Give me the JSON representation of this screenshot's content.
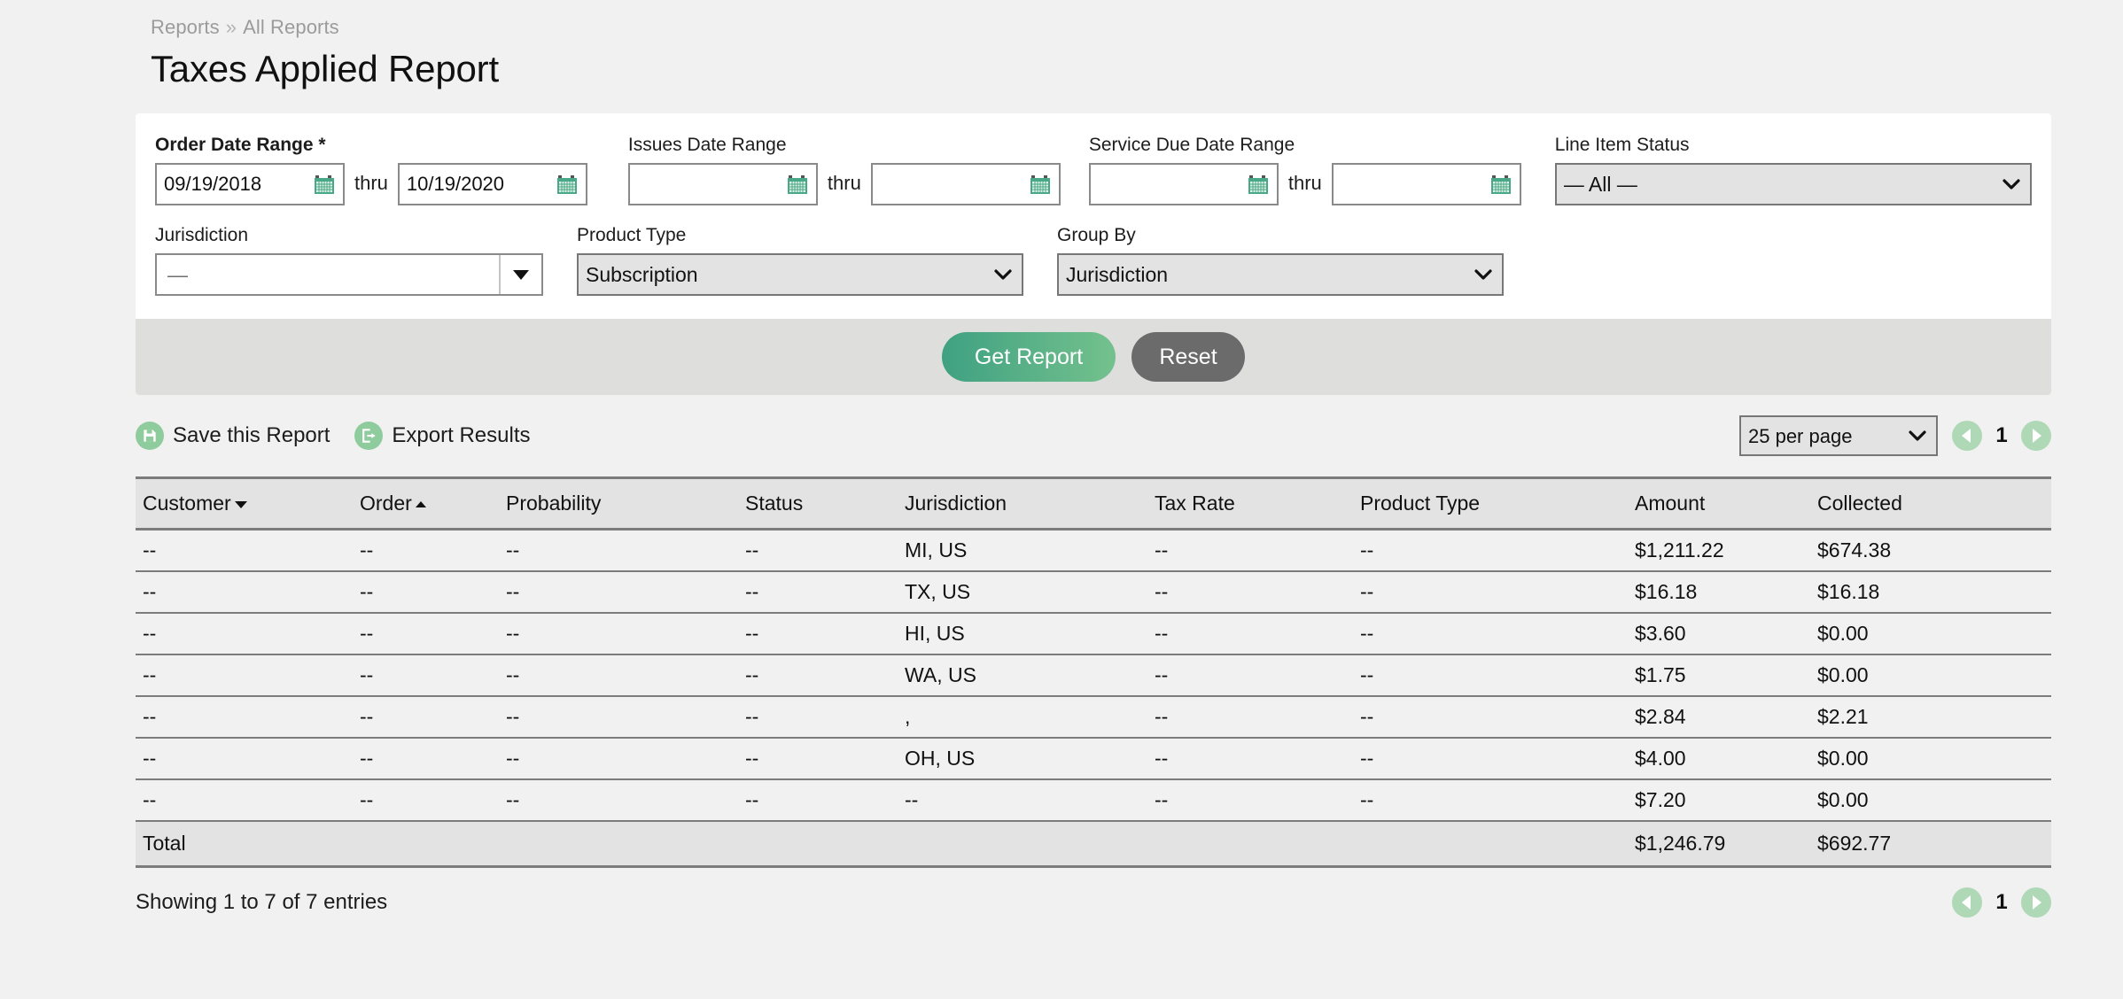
{
  "breadcrumb": {
    "parent": "Reports",
    "separator": "»",
    "current": "All Reports"
  },
  "page_title": "Taxes Applied Report",
  "filters": {
    "order_date_range": {
      "label": "Order Date Range *",
      "from_value": "09/19/2018",
      "to_value": "10/19/2020",
      "thru": "thru"
    },
    "issues_date_range": {
      "label": "Issues Date Range",
      "from_value": "",
      "to_value": "",
      "thru": "thru"
    },
    "service_due_date_range": {
      "label": "Service Due Date Range",
      "from_value": "",
      "to_value": "",
      "thru": "thru"
    },
    "line_item_status": {
      "label": "Line Item Status",
      "value": "— All —",
      "options": [
        "— All —"
      ]
    },
    "jurisdiction": {
      "label": "Jurisdiction",
      "value": "—"
    },
    "product_type": {
      "label": "Product Type",
      "value": "Subscription",
      "options": [
        "Subscription"
      ]
    },
    "group_by": {
      "label": "Group By",
      "value": "Jurisdiction",
      "options": [
        "Jurisdiction"
      ]
    }
  },
  "actions": {
    "get_report": "Get Report",
    "reset": "Reset",
    "primary_color": "#58b088",
    "secondary_color": "#6b6b6b"
  },
  "toolbar": {
    "save_report": "Save this Report",
    "export_results": "Export Results",
    "per_page": "25 per page",
    "per_page_options": [
      "25 per page"
    ],
    "page_number": "1",
    "accent_color": "#8fcc9d"
  },
  "table": {
    "columns": [
      "Customer",
      "Order",
      "Probability",
      "Status",
      "Jurisdiction",
      "Tax Rate",
      "Product Type",
      "Amount",
      "Collected"
    ],
    "sort": {
      "customer": "desc",
      "order": "asc"
    },
    "rows": [
      [
        "--",
        "--",
        "--",
        "--",
        "MI, US",
        "--",
        "--",
        "$1,211.22",
        "$674.38"
      ],
      [
        "--",
        "--",
        "--",
        "--",
        "TX, US",
        "--",
        "--",
        "$16.18",
        "$16.18"
      ],
      [
        "--",
        "--",
        "--",
        "--",
        "HI, US",
        "--",
        "--",
        "$3.60",
        "$0.00"
      ],
      [
        "--",
        "--",
        "--",
        "--",
        "WA, US",
        "--",
        "--",
        "$1.75",
        "$0.00"
      ],
      [
        "--",
        "--",
        "--",
        "--",
        ",",
        "--",
        "--",
        "$2.84",
        "$2.21"
      ],
      [
        "--",
        "--",
        "--",
        "--",
        "OH, US",
        "--",
        "--",
        "$4.00",
        "$0.00"
      ],
      [
        "--",
        "--",
        "--",
        "--",
        "--",
        "--",
        "--",
        "$7.20",
        "$0.00"
      ]
    ],
    "total": {
      "label": "Total",
      "amount": "$1,246.79",
      "collected": "$692.77"
    }
  },
  "footer": {
    "showing": "Showing 1 to 7 of 7 entries",
    "page_number": "1"
  }
}
